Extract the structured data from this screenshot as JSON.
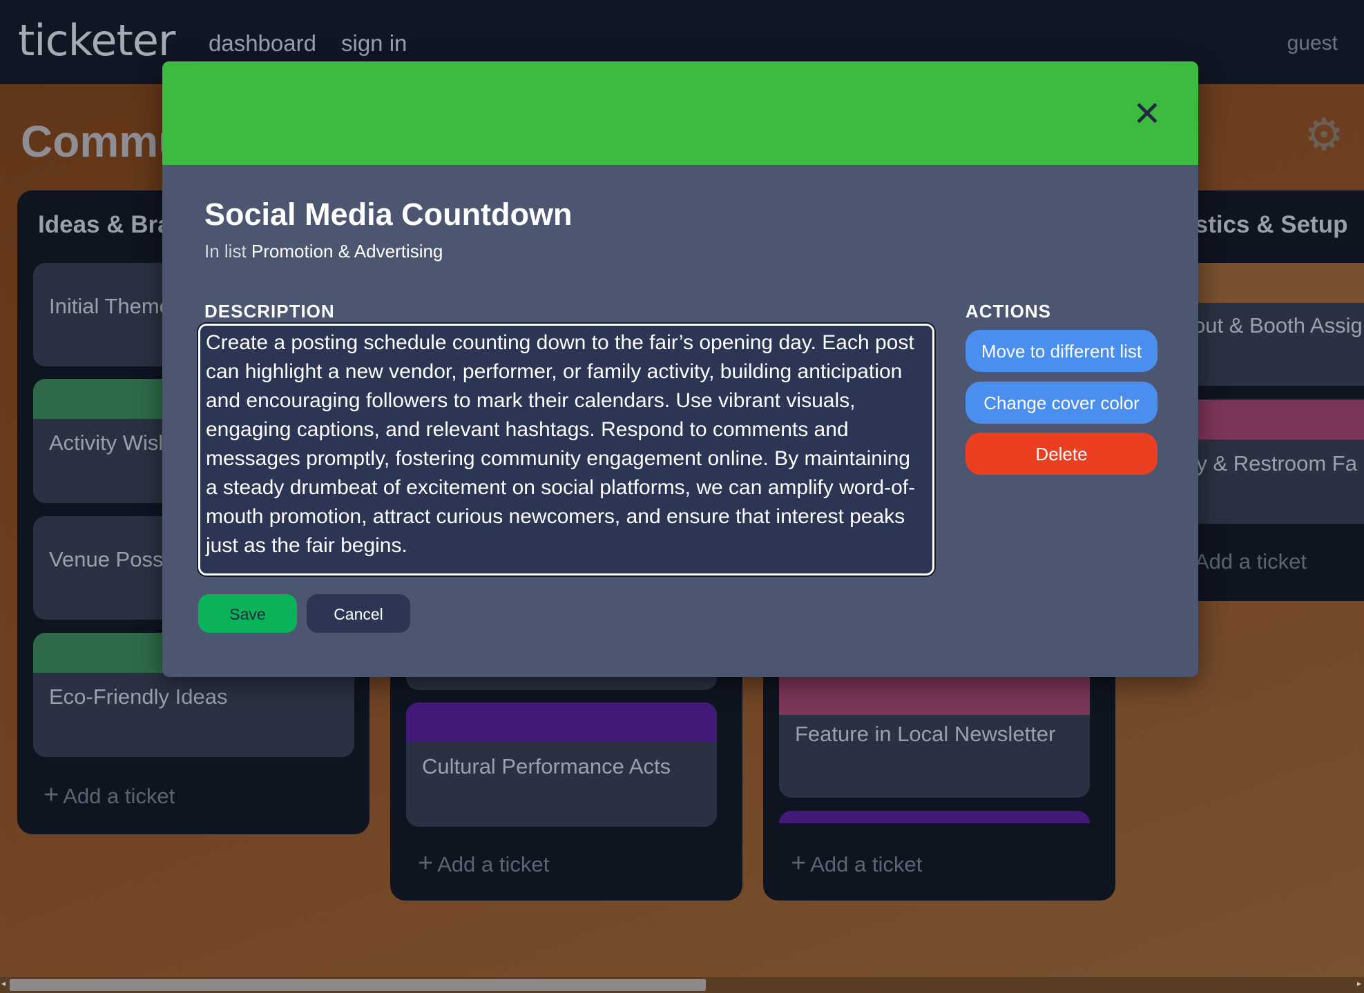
{
  "app": {
    "logo": "ticketer",
    "nav": {
      "dashboard": "dashboard",
      "sign_in": "sign in"
    },
    "user": "guest"
  },
  "board": {
    "title": "Commu",
    "gear_icon": "gear-icon"
  },
  "lists": {
    "ideas": {
      "title": "Ideas & Brai",
      "cards": [
        "Initial Theme",
        "Activity Wisl",
        "Venue Possil",
        "Eco-Friendly Ideas"
      ],
      "add": "Add a ticket"
    },
    "middle": {
      "cards": [
        "Cultural Performance Acts"
      ],
      "add": "Add a ticket"
    },
    "promotion": {
      "cards": [
        "Feature in Local Newsletter"
      ],
      "add": "Add a ticket"
    },
    "logistics": {
      "title": "istics & Setup",
      "cards": [
        "out & Booth Assig",
        "lity & Restroom Fa"
      ],
      "add": "Add a ticket"
    }
  },
  "modal": {
    "cover_color": "#3dba40",
    "title": "Social Media Countdown",
    "in_list_prefix": "In list",
    "list_name": "Promotion & Advertising",
    "description_label": "DESCRIPTION",
    "description": "Create a posting schedule counting down to the fair’s opening day. Each post can highlight a new vendor, performer, or family activity, building anticipation and encouraging followers to mark their calendars. Use vibrant visuals, engaging captions, and relevant hashtags. Respond to comments and messages promptly, fostering community engagement online. By maintaining a steady drumbeat of excitement on social platforms, we can amplify word-of-mouth promotion, attract curious newcomers, and ensure that interest peaks just as the fair begins.",
    "actions_label": "ACTIONS",
    "actions": {
      "move": "Move to different list",
      "change_color": "Change cover color",
      "delete": "Delete"
    },
    "save": "Save",
    "cancel": "Cancel"
  },
  "colors": {
    "green_cover": "#2e6a4a",
    "purple_cover": "#421b7a",
    "pink_cover": "#7c3659",
    "accent_blue": "#4a8ef0",
    "danger": "#ec3f21",
    "save_green": "#0ab35a"
  }
}
